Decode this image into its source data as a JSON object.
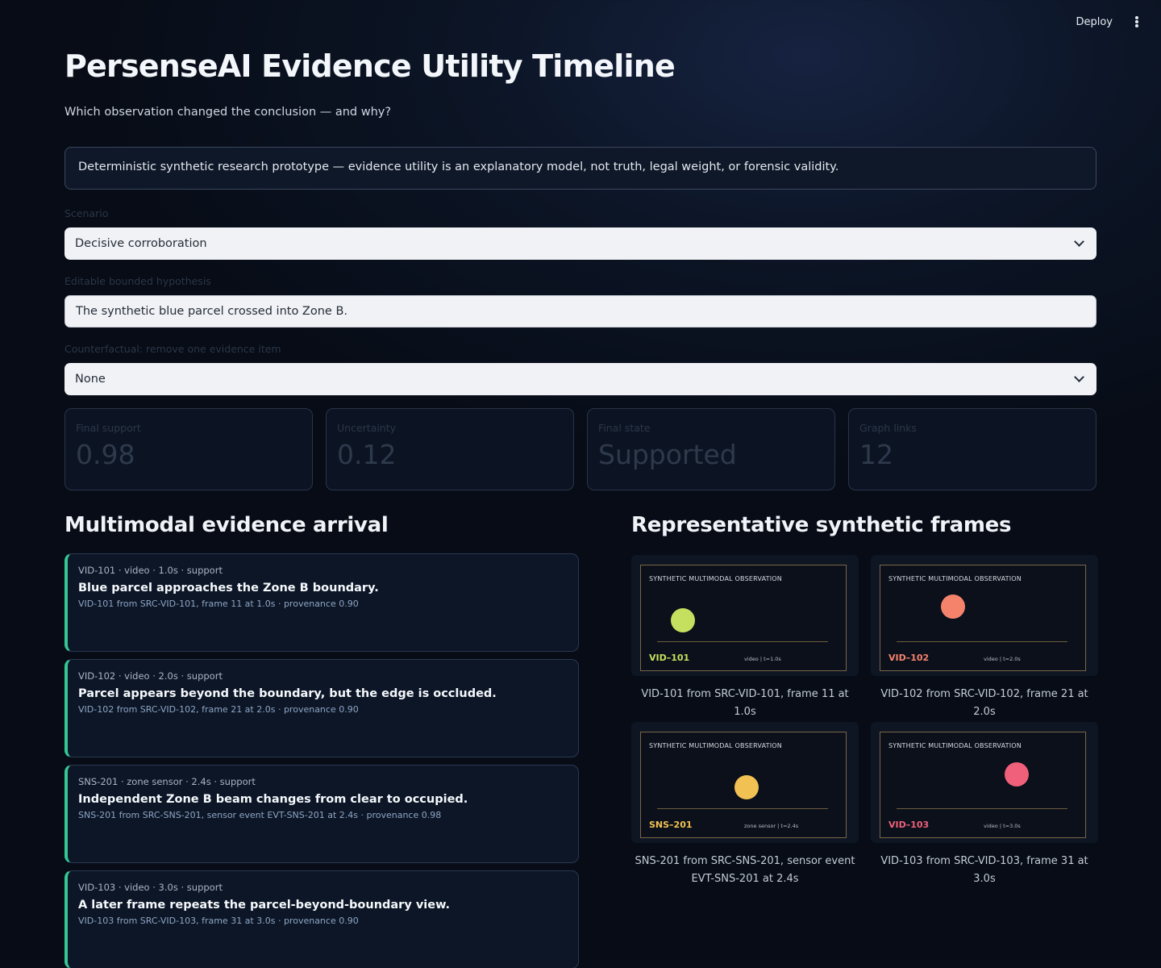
{
  "header": {
    "deploy_label": "Deploy",
    "menu_icon": "kebab-menu-icon"
  },
  "page": {
    "title": "PersenseAI Evidence Utility Timeline",
    "subtitle": "Which observation changed the conclusion — and why?",
    "notice": "Deterministic synthetic research prototype — evidence utility is an explanatory model, not truth, legal weight, or forensic validity."
  },
  "controls": {
    "scenario": {
      "label": "Scenario",
      "value": "Decisive corroboration"
    },
    "hypothesis": {
      "label": "Editable bounded hypothesis",
      "value": "The synthetic blue parcel crossed into Zone B."
    },
    "counterfactual": {
      "label": "Counterfactual: remove one evidence item",
      "value": "None"
    }
  },
  "metrics": [
    {
      "label": "Final support",
      "value": "0.98"
    },
    {
      "label": "Uncertainty",
      "value": "0.12"
    },
    {
      "label": "Final state",
      "value": "Supported"
    },
    {
      "label": "Graph links",
      "value": "12"
    }
  ],
  "evidence": {
    "heading": "Multimodal evidence arrival",
    "items": [
      {
        "meta": "VID-101 · video · 1.0s · support",
        "title": "Blue parcel approaches the Zone B boundary.",
        "provenance": "VID-101 from SRC-VID-101, frame 11 at 1.0s · provenance 0.90"
      },
      {
        "meta": "VID-102 · video · 2.0s · support",
        "title": "Parcel appears beyond the boundary, but the edge is occluded.",
        "provenance": "VID-102 from SRC-VID-102, frame 21 at 2.0s · provenance 0.90"
      },
      {
        "meta": "SNS-201 · zone sensor · 2.4s · support",
        "title": "Independent Zone B beam changes from clear to occupied.",
        "provenance": "SNS-201 from SRC-SNS-201, sensor event EVT-SNS-201 at 2.4s · provenance 0.98"
      },
      {
        "meta": "VID-103 · video · 3.0s · support",
        "title": "A later frame repeats the parcel-beyond-boundary view.",
        "provenance": "VID-103 from SRC-VID-103, frame 31 at 3.0s · provenance 0.90"
      }
    ]
  },
  "frames": {
    "heading": "Representative synthetic frames",
    "items": [
      {
        "header": "SYNTHETIC MULTIMODAL OBSERVATION",
        "id": "VID–101",
        "sub": "video | t=1.0s",
        "dot_color": "#c5e05e",
        "id_color": "#c5e05e",
        "caption": "VID-101 from SRC-VID-101, frame 11 at 1.0s"
      },
      {
        "header": "SYNTHETIC MULTIMODAL OBSERVATION",
        "id": "VID–102",
        "sub": "video | t=2.0s",
        "dot_color": "#f5836c",
        "id_color": "#f5836c",
        "caption": "VID-102 from SRC-VID-102, frame 21 at 2.0s"
      },
      {
        "header": "SYNTHETIC MULTIMODAL OBSERVATION",
        "id": "SNS–201",
        "sub": "zone sensor | t=2.4s",
        "dot_color": "#f2c154",
        "id_color": "#f2c154",
        "caption": "SNS-201 from SRC-SNS-201, sensor event EVT-SNS-201 at 2.4s"
      },
      {
        "header": "SYNTHETIC MULTIMODAL OBSERVATION",
        "id": "VID–103",
        "sub": "video | t=3.0s",
        "dot_color": "#f0607a",
        "id_color": "#f0607a",
        "caption": "VID-103 from SRC-VID-103, frame 31 at 3.0s"
      }
    ]
  },
  "colors": {
    "accent": "#35c796",
    "background": "#070c16"
  }
}
